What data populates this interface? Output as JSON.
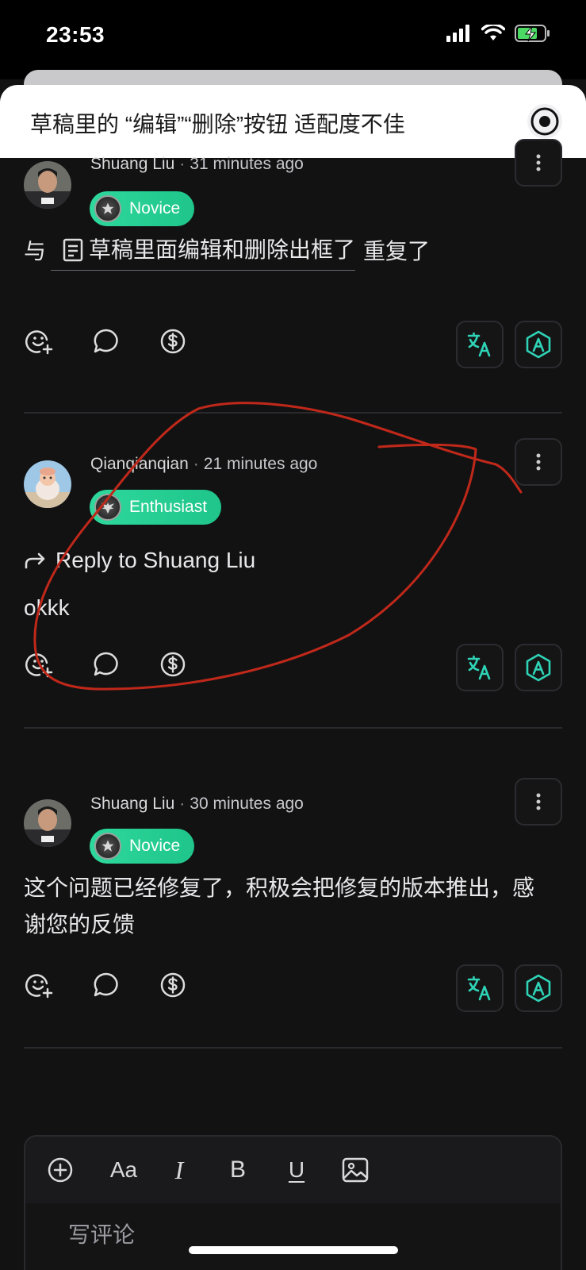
{
  "status_bar": {
    "time": "23:53"
  },
  "sheet": {
    "title": "草稿里的 “编辑”“删除”按钮 适配度不佳"
  },
  "comments": [
    {
      "author": "Shuang Liu",
      "separator": "·",
      "time": "31 minutes ago",
      "badge": "Novice",
      "text_prefix": "与",
      "draft_title": "草稿里面编辑和删除出框了",
      "text_suffix": "重复了"
    },
    {
      "author": "Qianqianqian",
      "separator": "·",
      "time": "21 minutes ago",
      "badge": "Enthusiast",
      "reply_to": "Reply to Shuang Liu",
      "text": "okkk"
    },
    {
      "author": "Shuang Liu",
      "separator": "·",
      "time": "30 minutes ago",
      "badge": "Novice",
      "text": "这个问题已经修复了，积极会把修复的版本推出，感谢您的反馈"
    }
  ],
  "composer": {
    "placeholder": "写评论",
    "toolbar": {
      "font_label": "Aa",
      "italic_label": "I",
      "bold_label": "B",
      "underline_label": "U"
    }
  },
  "colors": {
    "accent": "#2ed89c",
    "teal_icon": "#2fd3b6",
    "annotation": "#c0281a"
  }
}
